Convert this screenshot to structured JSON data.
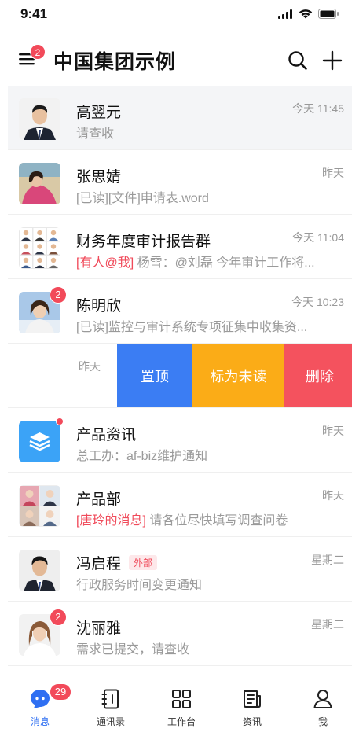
{
  "status": {
    "time": "9:41"
  },
  "header": {
    "title": "中国集团示例",
    "menu_badge": "2"
  },
  "chats": [
    {
      "name": "高翌元",
      "time": "今天 11:45",
      "preview": "请查收"
    },
    {
      "name": "张思婧",
      "time": "昨天",
      "preview": "[已读][文件]申请表.word"
    },
    {
      "name": "财务年度审计报告群",
      "time": "今天 11:04",
      "mention": "[有人@我]",
      "preview": " 杨雪：@刘磊 今年审计工作将..."
    },
    {
      "name": "陈明欣",
      "time": "今天 10:23",
      "preview": "[已读]监控与审计系统专项征集中收集资...",
      "badge": "2"
    }
  ],
  "swiped": {
    "time": "昨天",
    "pin_label": "置顶",
    "unread_label": "标为未读",
    "delete_label": "删除"
  },
  "chats2": [
    {
      "name": "产品资讯",
      "time": "昨天",
      "preview": "总工办：af-biz维护通知"
    },
    {
      "name": "产品部",
      "time": "昨天",
      "mention": "[唐玲的消息]",
      "preview": " 请各位尽快填写调查问卷"
    },
    {
      "name": "冯启程",
      "time": "星期二",
      "tag": "外部",
      "preview": "行政服务时间变更通知"
    },
    {
      "name": "沈丽雅",
      "time": "星期二",
      "preview": "需求已提交，请查收",
      "badge": "2"
    }
  ],
  "tabs": [
    {
      "label": "消息",
      "icon": "chat-bubble-icon",
      "badge": "29"
    },
    {
      "label": "通讯录",
      "icon": "contacts-book-icon"
    },
    {
      "label": "工作台",
      "icon": "grid-apps-icon"
    },
    {
      "label": "资讯",
      "icon": "news-icon"
    },
    {
      "label": "我",
      "icon": "person-icon"
    }
  ],
  "colors": {
    "accent": "#2f6ff2",
    "badge": "#f24a5a",
    "pin": "#3b7df3",
    "unread": "#fbac17",
    "delete": "#f4525e"
  }
}
